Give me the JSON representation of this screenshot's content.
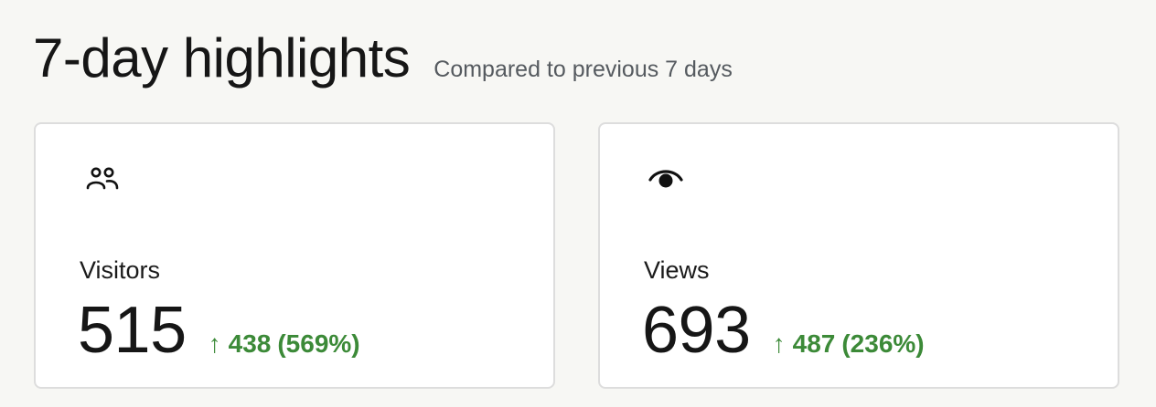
{
  "header": {
    "title": "7-day highlights",
    "subtitle": "Compared to previous 7 days"
  },
  "cards": [
    {
      "icon": "users-icon",
      "label": "Visitors",
      "value": "515",
      "change_arrow": "↑",
      "change_value": "438",
      "change_percent": "(569%)"
    },
    {
      "icon": "eye-icon",
      "label": "Views",
      "value": "693",
      "change_arrow": "↑",
      "change_value": "487",
      "change_percent": "(236%)"
    }
  ],
  "colors": {
    "positive_change": "#3c8a38",
    "background": "#f7f7f4",
    "card_border": "#dddddd"
  }
}
